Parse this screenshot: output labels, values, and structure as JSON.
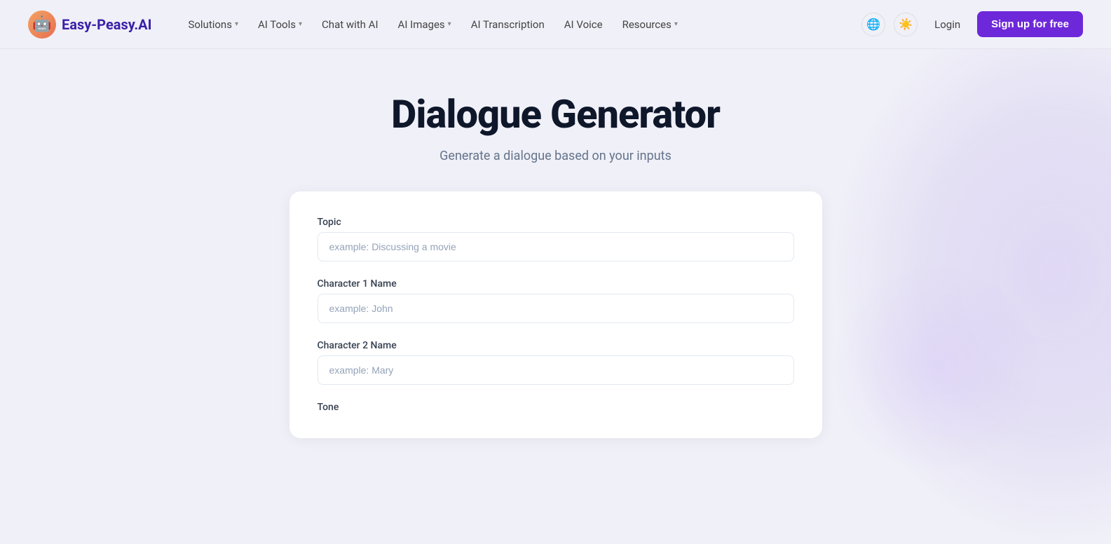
{
  "brand": {
    "name": "Easy-Peasy.AI",
    "logo_emoji": "🤖"
  },
  "nav": {
    "links": [
      {
        "label": "Solutions",
        "has_dropdown": true,
        "active": false
      },
      {
        "label": "AI Tools",
        "has_dropdown": true,
        "active": false
      },
      {
        "label": "Chat with AI",
        "has_dropdown": false,
        "active": false
      },
      {
        "label": "AI Images",
        "has_dropdown": true,
        "active": false
      },
      {
        "label": "AI Transcription",
        "has_dropdown": false,
        "active": false
      },
      {
        "label": "AI Voice",
        "has_dropdown": false,
        "active": false
      },
      {
        "label": "Resources",
        "has_dropdown": true,
        "active": false
      }
    ],
    "login_label": "Login",
    "signup_label": "Sign up for free"
  },
  "hero": {
    "title": "Dialogue Generator",
    "subtitle": "Generate a dialogue based on your inputs"
  },
  "form": {
    "fields": [
      {
        "id": "topic",
        "label": "Topic",
        "placeholder": "example: Discussing a movie",
        "value": ""
      },
      {
        "id": "character1",
        "label": "Character 1 Name",
        "placeholder": "example: John",
        "value": ""
      },
      {
        "id": "character2",
        "label": "Character 2 Name",
        "placeholder": "example: Mary",
        "value": ""
      },
      {
        "id": "tone",
        "label": "Tone",
        "placeholder": "",
        "value": ""
      }
    ]
  },
  "icons": {
    "globe": "🌐",
    "theme": "☀️",
    "chevron_down": "▾"
  }
}
